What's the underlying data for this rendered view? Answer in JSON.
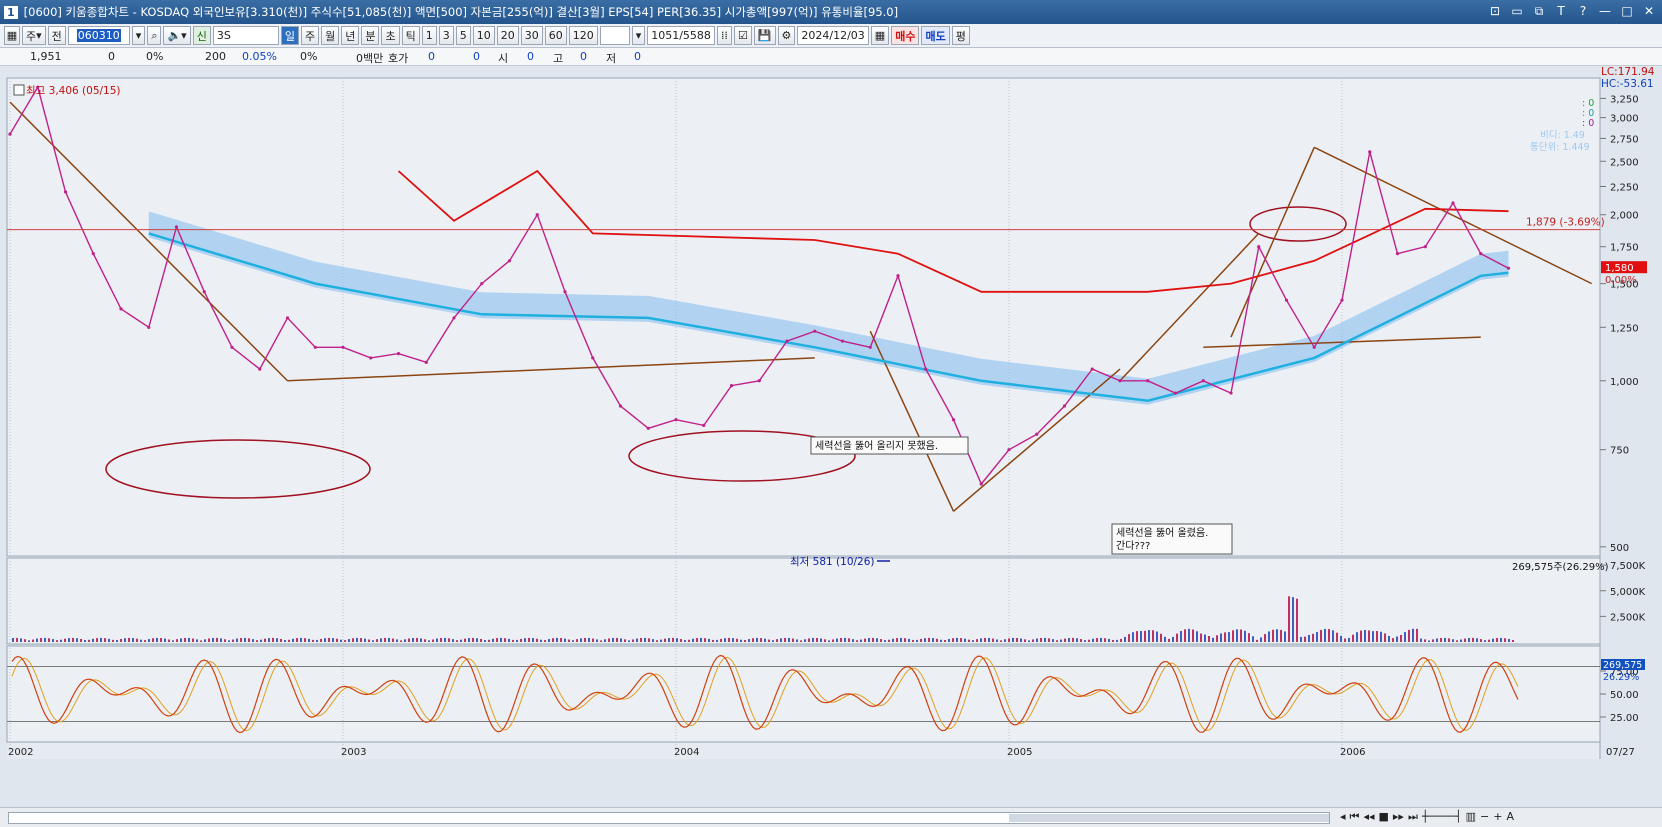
{
  "window": {
    "number": "1",
    "title": "[0600] 키움종합차트 - KOSDAQ 외국인보유[3.310(천)] 주식수[51,085(천)] 액면[500] 자본금[255(억)] 결산[3월] EPS[54] PER[36.35] 시가총액[997(억)] 유통비율[95.0]",
    "controls": [
      "⊡",
      "▭",
      "⧉",
      "T",
      "?",
      "—",
      "□",
      "✕"
    ]
  },
  "toolbar": {
    "type_label": "주",
    "scope_label": "전",
    "code": "060310",
    "search_icon": "search-icon",
    "speaker_icon": "speaker-icon",
    "badge_sin": "신",
    "stock_name": "3S",
    "periods": [
      "일",
      "주",
      "월",
      "년",
      "분",
      "초",
      "틱"
    ],
    "selected_period": "일",
    "intervals": [
      "1",
      "3",
      "5",
      "10",
      "20",
      "30",
      "60",
      "120"
    ],
    "count": "1051/5588",
    "date": "2024/12/03",
    "buy_label": "매수",
    "sell_label": "매도",
    "pyeong_label": "평"
  },
  "quote": {
    "price": "1,951",
    "change": "0",
    "change_pct": "0%",
    "volume": "200",
    "volume_pct": "0.05%",
    "turnover": "0%",
    "amount": "0백만",
    "hoga_label": "호가",
    "hoga_bid": "0",
    "hoga_ask": "0",
    "open_label": "시",
    "open": "0",
    "high_label": "고",
    "high": "0",
    "low_label": "저",
    "low": "0"
  },
  "legend": {
    "lc": "LC:171.94",
    "hc": "HC:-53.61",
    "small_0a": ": 0",
    "small_0b": ": 0",
    "small_0c": ": 0",
    "hidden_a": "비디: 1.49",
    "hidden_b": "통단위: 1.449"
  },
  "annotations": {
    "high": "최고 3,406 (05/15)",
    "low": "최저 581 (10/26)",
    "hline_label": "1,879 (-3.69%)",
    "price_tag": "1,580",
    "price_tag_pct": "0.00%",
    "note1": "세력선을 뚫어 올리지 못했음.",
    "note2a": "세력선을 뚫어 올렸음.",
    "note2b": "간다???",
    "vol_label": "269,575주(26.29%)",
    "vol_tag": "269,575",
    "vol_tag_pct": "26.29%",
    "last_date": "07/27"
  },
  "colors": {
    "price_line": "#c0208a",
    "ma_line": "#20b0e0",
    "envelope": "#e01010",
    "trend": "#8b4513",
    "ellipse": "#a01020",
    "cloud": "#8ac0ef",
    "stoch_k": "#d04010",
    "stoch_d": "#e0a020"
  },
  "chart_data": [
    {
      "type": "line",
      "title": "",
      "ylabel": "",
      "yscale": "log",
      "ylim": [
        500,
        3406
      ],
      "y_ticks": [
        500,
        750,
        1000,
        1250,
        1500,
        1750,
        2000,
        2250,
        2500,
        2750,
        3000,
        3250
      ],
      "y_tick_labels": [
        "500",
        "750",
        "1,000",
        "1,250",
        "1,500",
        "1,750",
        "2,000",
        "2,250",
        "2,500",
        "2,750",
        "3,000",
        "3,250"
      ],
      "x_tick_labels": [
        "2002",
        "2003",
        "2004",
        "2005",
        "2006"
      ],
      "x_tick_dates": [
        "2002-01",
        "2003-01",
        "2004-01",
        "2005-01",
        "2006-01"
      ],
      "series": [
        {
          "key": "close",
          "x": [
            "2002-01",
            "2002-02",
            "2002-03",
            "2002-04",
            "2002-05",
            "2002-06",
            "2002-07",
            "2002-08",
            "2002-09",
            "2002-10",
            "2002-11",
            "2002-12",
            "2003-01",
            "2003-02",
            "2003-03",
            "2003-04",
            "2003-05",
            "2003-06",
            "2003-07",
            "2003-08",
            "2003-09",
            "2003-10",
            "2003-11",
            "2003-12",
            "2004-01",
            "2004-02",
            "2004-03",
            "2004-04",
            "2004-05",
            "2004-06",
            "2004-07",
            "2004-08",
            "2004-09",
            "2004-10",
            "2004-11",
            "2004-12",
            "2005-01",
            "2005-02",
            "2005-03",
            "2005-04",
            "2005-05",
            "2005-06",
            "2005-07",
            "2005-08",
            "2005-09",
            "2005-10",
            "2005-11",
            "2005-12",
            "2006-01",
            "2006-02",
            "2006-03",
            "2006-04",
            "2006-05",
            "2006-06",
            "2006-07"
          ],
          "values": [
            2800,
            3406,
            2200,
            1700,
            1350,
            1250,
            1900,
            1450,
            1150,
            1050,
            1300,
            1150,
            1150,
            1100,
            1120,
            1080,
            1300,
            1500,
            1650,
            2000,
            1450,
            1100,
            900,
            820,
            850,
            830,
            980,
            1000,
            1180,
            1230,
            1180,
            1150,
            1550,
            1050,
            850,
            650,
            750,
            800,
            900,
            1050,
            1000,
            1000,
            950,
            1000,
            950,
            1750,
            1400,
            1150,
            1400,
            2600,
            1700,
            1750,
            2100,
            1700,
            1600
          ]
        },
        {
          "key": "moving_average",
          "x": [
            "2002-06",
            "2002-12",
            "2003-06",
            "2003-12",
            "2004-06",
            "2004-12",
            "2005-06",
            "2005-12",
            "2006-06",
            "2006-07"
          ],
          "values": [
            1850,
            1500,
            1320,
            1300,
            1150,
            1000,
            920,
            1100,
            1550,
            1570
          ]
        },
        {
          "key": "envelope",
          "x": [
            "2003-03",
            "2003-05",
            "2003-08",
            "2003-10",
            "2004-06",
            "2004-09",
            "2004-12",
            "2005-06",
            "2005-09",
            "2005-12",
            "2006-04",
            "2006-07"
          ],
          "values": [
            2400,
            1950,
            2400,
            1850,
            1800,
            1700,
            1450,
            1450,
            1500,
            1650,
            2050,
            2030
          ]
        }
      ],
      "hline": 1879,
      "last_price": 1580,
      "high": {
        "value": 3406,
        "date": "05/15"
      },
      "low": {
        "value": 581,
        "date": "10/26"
      }
    },
    {
      "type": "bar",
      "title": "",
      "ylim": [
        0,
        8000
      ],
      "y_ticks": [
        2500,
        5000,
        7500
      ],
      "y_tick_labels": [
        "2,500K",
        "5,000K",
        "7,500K"
      ],
      "last_volume": 269575,
      "last_volume_pct": 26.29
    },
    {
      "type": "line",
      "title": "",
      "ylim": [
        0,
        100
      ],
      "y_ticks": [
        25,
        50,
        75
      ],
      "y_tick_labels": [
        "25.00",
        "50.00",
        "75.00"
      ],
      "overbought": 80,
      "oversold": 20
    }
  ]
}
